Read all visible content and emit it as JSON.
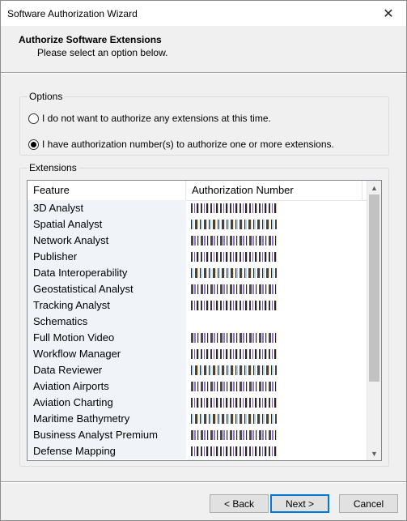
{
  "window": {
    "title": "Software Authorization Wizard"
  },
  "header": {
    "title": "Authorize Software Extensions",
    "subtitle": "Please select an option below."
  },
  "options": {
    "legend": "Options",
    "radio_none": "I do not want to authorize any extensions at this time.",
    "radio_authorize": "I have authorization number(s) to authorize one or more extensions.",
    "selected": "authorize"
  },
  "extensions": {
    "legend": "Extensions",
    "columns": [
      "Feature",
      "Authorization Number"
    ],
    "rows": [
      "3D Analyst",
      "Spatial Analyst",
      "Network Analyst",
      "Publisher",
      "Data Interoperability",
      "Geostatistical Analyst",
      "Tracking Analyst",
      "Schematics",
      "Full Motion Video",
      "Workflow Manager",
      "Data Reviewer",
      "Aviation Airports",
      "Aviation Charting",
      "Maritime Bathymetry",
      "Business Analyst Premium",
      "Defense Mapping"
    ]
  },
  "buttons": {
    "back": "< Back",
    "next": "Next >",
    "cancel": "Cancel"
  },
  "icons": {
    "close": "close-icon",
    "scroll_up": "chevron-up-icon",
    "scroll_down": "chevron-down-icon"
  }
}
